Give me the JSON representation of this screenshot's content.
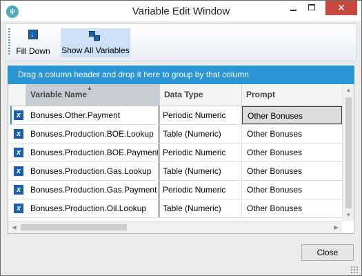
{
  "window": {
    "title": "Variable Edit Window",
    "close_symbol": "✕"
  },
  "toolbar": {
    "fill_down_label": "Fill Down",
    "show_all_label": "Show All Variables"
  },
  "group_panel": {
    "text": "Drag a column header and drop it here to group by that column"
  },
  "grid": {
    "columns": [
      "Variable Name",
      "Data Type",
      "Prompt"
    ],
    "sorted_column": "Variable Name",
    "rows": [
      {
        "name": "Bonuses.Other.Payment",
        "type": "Periodic Numeric",
        "prompt": "Other Bonuses",
        "selected": true
      },
      {
        "name": "Bonuses.Production.BOE.Lookup",
        "type": "Table (Numeric)",
        "prompt": "Other Bonuses"
      },
      {
        "name": "Bonuses.Production.BOE.Payment",
        "type": "Periodic Numeric",
        "prompt": "Other Bonuses"
      },
      {
        "name": "Bonuses.Production.Gas.Lookup",
        "type": "Table (Numeric)",
        "prompt": "Other Bonuses"
      },
      {
        "name": "Bonuses.Production.Gas.Payment",
        "type": "Periodic Numeric",
        "prompt": "Other Bonuses"
      },
      {
        "name": "Bonuses.Production.Oil.Lookup",
        "type": "Table (Numeric)",
        "prompt": "Other Bonuses"
      }
    ],
    "row_icon_glyph": "x"
  },
  "footer": {
    "close_label": "Close"
  },
  "colors": {
    "accent": "#2a96d6",
    "variable_icon": "#1b5faa",
    "window_close": "#c7463e"
  }
}
